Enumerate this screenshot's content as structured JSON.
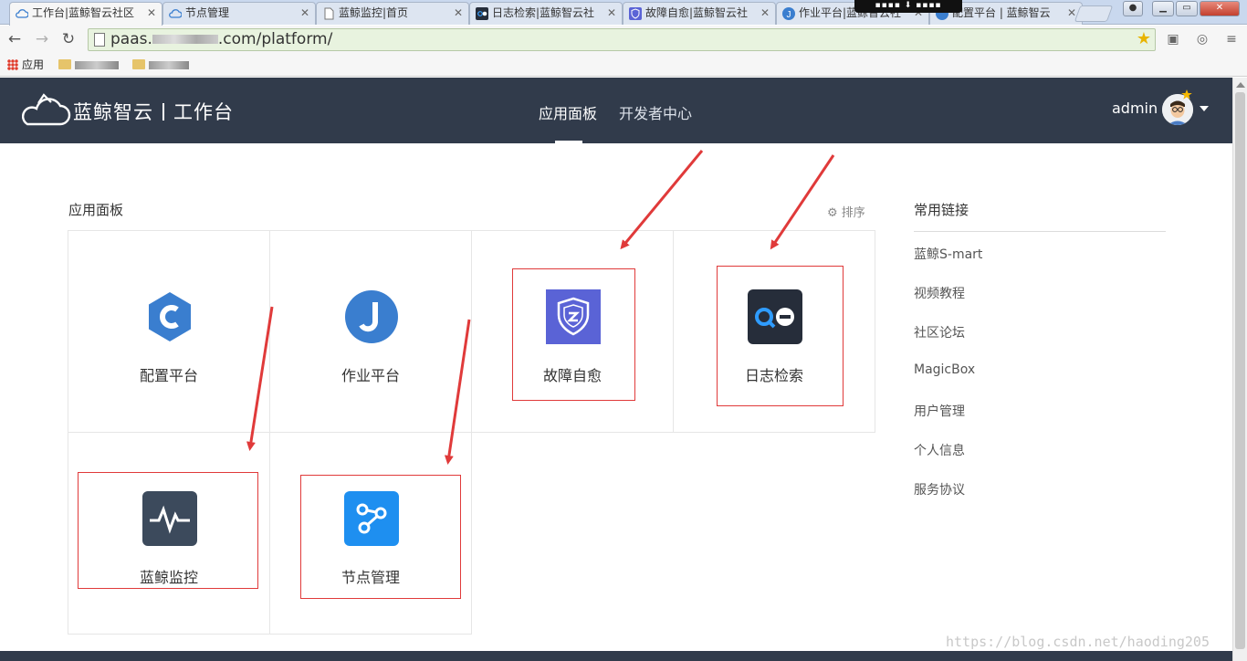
{
  "browser": {
    "tabs": [
      {
        "title": "工作台|蓝鲸智云社区",
        "active": true
      },
      {
        "title": "节点管理"
      },
      {
        "title": "蓝鲸监控|首页"
      },
      {
        "title": "日志检索|蓝鲸智云社"
      },
      {
        "title": "故障自愈|蓝鲸智云社"
      },
      {
        "title": "作业平台|蓝鲸智云社"
      },
      {
        "title": "配置平台 | 蓝鲸智云"
      }
    ],
    "url_prefix": "paas.",
    "url_suffix": ".com/platform/",
    "bookmarks": {
      "apps_label": "应用"
    }
  },
  "header": {
    "brand": "蓝鲸智云",
    "brand_section": "工作台",
    "nav": [
      {
        "label": "应用面板",
        "active": true
      },
      {
        "label": "开发者中心",
        "active": false
      }
    ],
    "user": "admin"
  },
  "panel": {
    "title": "应用面板",
    "sort_label": "排序",
    "apps": [
      {
        "name": "配置平台",
        "icon": "config-platform-icon",
        "color": "#3a7ecf",
        "highlighted": false
      },
      {
        "name": "作业平台",
        "icon": "job-platform-icon",
        "color": "#3a7ecf",
        "highlighted": false
      },
      {
        "name": "故障自愈",
        "icon": "fault-heal-icon",
        "color": "#5a63d6",
        "highlighted": true
      },
      {
        "name": "日志检索",
        "icon": "log-search-icon",
        "color": "#262d3a",
        "highlighted": true
      },
      {
        "name": "蓝鲸监控",
        "icon": "monitor-icon",
        "color": "#3c4a5c",
        "highlighted": true
      },
      {
        "name": "节点管理",
        "icon": "node-manage-icon",
        "color": "#1e8ff0",
        "highlighted": true
      }
    ]
  },
  "links": {
    "title": "常用链接",
    "items": [
      "蓝鲸S-mart",
      "视频教程",
      "社区论坛",
      "MagicBox",
      "用户管理",
      "个人信息",
      "服务协议"
    ]
  },
  "annotation_color": "#e03a3a",
  "watermark": "https://blog.csdn.net/haoding205"
}
